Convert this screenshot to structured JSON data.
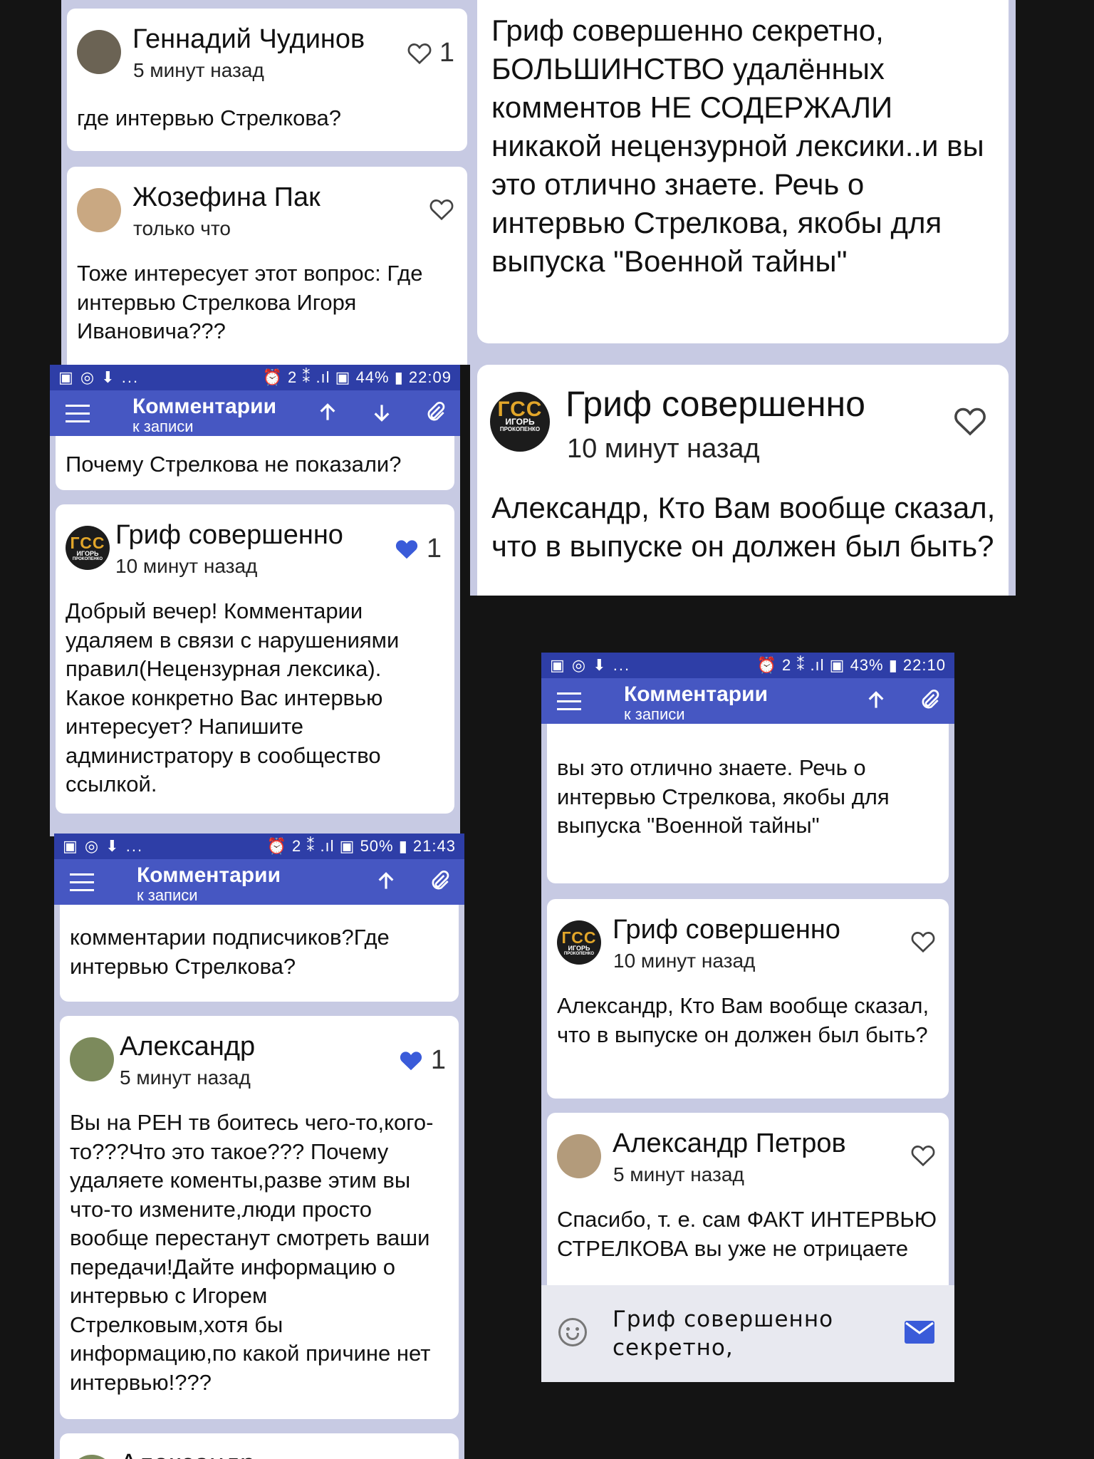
{
  "s1": {
    "c1": {
      "name": "Геннадий Чудинов",
      "time": "5 минут назад",
      "likes": "1",
      "text": "где интервью Стрелкова?"
    },
    "c2": {
      "name": "Жозефина Пак",
      "time": "только что",
      "text": "Тоже интересует этот вопрос: Где интервью Стрелкова Игоря Ивановича???"
    }
  },
  "s2": {
    "text": "Гриф совершенно секретно, БОЛЬШИНСТВО удалённых комментов НЕ СОДЕРЖАЛИ никакой нецензурной лексики..и вы это отлично знаете. Речь о интервью Стрелкова, якобы для выпуска \"Военной тайны\"",
    "c": {
      "name": "Гриф совершенно",
      "time": "10 минут назад",
      "text": "Александр, Кто Вам вообще сказал, что в выпуске он должен был быть?"
    }
  },
  "s3": {
    "status": {
      "left": "▣ ◎ ⬇ ...",
      "right": "⏰ 2 ⁑ .ıl ▣ 44% ▮ 22:09"
    },
    "appbar": {
      "title": "Комментарии",
      "subtitle": "к записи"
    },
    "partial": "Почему Стрелкова не показали?",
    "c": {
      "name": "Гриф совершенно",
      "time": "10 минут назад",
      "likes": "1",
      "text": "Добрый вечер! Комментарии удаляем в связи с нарушениями правил(Нецензурная лексика). Какое конкретно Вас интервью интересует? Напишите администратору в сообщество ссылкой."
    }
  },
  "s4": {
    "status": {
      "left": "▣ ◎ ⬇ ...",
      "right": "⏰ 2 ⁑ .ıl ▣ 50% ▮ 21:43"
    },
    "appbar": {
      "title": "Комментарии",
      "subtitle": "к записи"
    },
    "partial": "комментарии подписчиков?Где интервью Стрелкова?",
    "c": {
      "name": "Александр",
      "time": "5 минут назад",
      "likes": "1",
      "text": "Вы на РЕН тв боитесь чего-то,кого-то???Что это такое??? Почему удаляете коменты,разве этим вы что-то измените,люди просто вообще перестанут смотреть ваши передачи!Дайте информацию о интервью с Игорем Стрелковым,хотя бы информацию,по какой причине нет интервью!???"
    },
    "next_name": "Александр"
  },
  "s5": {
    "status": {
      "left": "▣ ◎ ⬇ ...",
      "right": "⏰ 2 ⁑ .ıl ▣ 43% ▮ 22:10"
    },
    "appbar": {
      "title": "Комментарии",
      "subtitle": "к записи"
    },
    "partial": "вы это отлично знаете. Речь о интервью Стрелкова, якобы для выпуска \"Военной тайны\"",
    "c1": {
      "name": "Гриф совершенно",
      "time": "10 минут назад",
      "text": "Александр, Кто Вам вообще сказал, что в выпуске он должен был быть?"
    },
    "c2": {
      "name": "Александр Петров",
      "time": "5 минут назад",
      "text": "Спасибо, т. е. сам ФАКТ ИНТЕРВЬЮ СТРЕЛКОВА вы уже не отрицаете"
    },
    "input": "Гриф совершенно секретно,"
  },
  "avatar_logo": {
    "line1": "ГСС",
    "line2": "ИГОРЬ",
    "line3": "ПРОКОПЕНКО"
  },
  "colors": {
    "accent": "#4657c2",
    "statusbar": "#2e3ea7",
    "like": "#3a5bd9",
    "background": "#c7cae3"
  }
}
